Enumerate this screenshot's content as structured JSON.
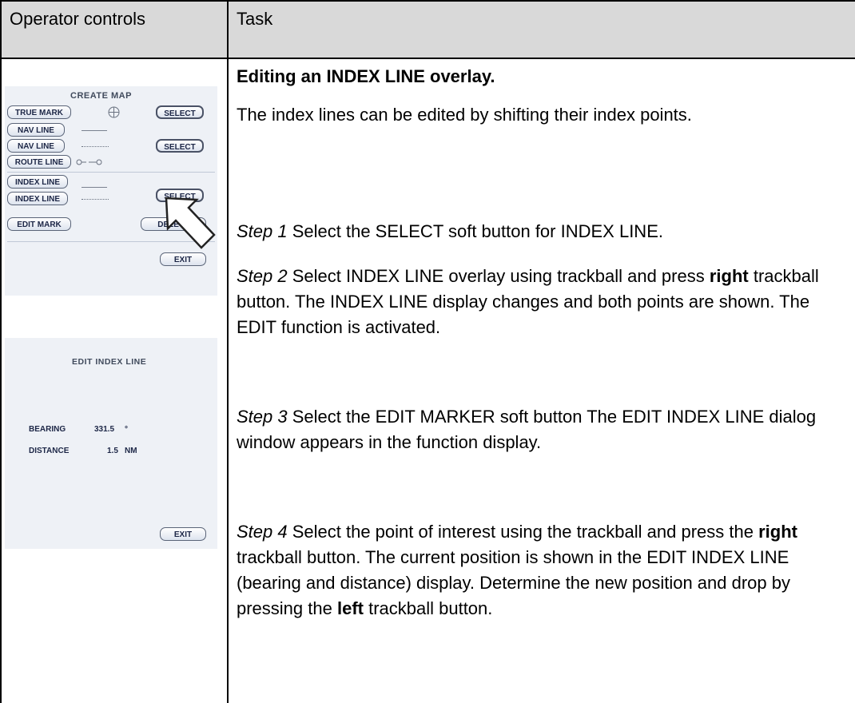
{
  "table": {
    "col1_header": "Operator controls",
    "col2_header": "Task"
  },
  "task": {
    "heading": "Editing an INDEX LINE overlay.",
    "intro": "The index lines can be edited by shifting their index points.",
    "step1": {
      "label": "Step 1",
      "text": " Select the SELECT soft button for INDEX LINE."
    },
    "step2": {
      "label": "Step 2",
      "text_a": " Select INDEX LINE overlay using trackball and press ",
      "bold": "right",
      "text_b": " trackball button. The INDEX LINE display changes and both points are shown. The EDIT function is activated."
    },
    "step3": {
      "label": "Step 3",
      "text": " Select the EDIT MARKER soft button The EDIT INDEX LINE dialog window appears in the function display."
    },
    "step4": {
      "label": "Step 4",
      "text_a": " Select the point of interest using the trackball and press the ",
      "bold1": "right",
      "text_b": " trackball button. The current position is shown in the EDIT INDEX LINE (bearing and distance) display. Determine the new position and drop by pressing the ",
      "bold2": "left",
      "text_c": " trackball button."
    }
  },
  "create_map_panel": {
    "title": "CREATE MAP",
    "true_mark": "TRUE MARK",
    "nav_line_1": "NAV LINE",
    "nav_line_2": "NAV LINE",
    "route_line": "ROUTE LINE",
    "index_line_1": "INDEX LINE",
    "index_line_2": "INDEX LINE",
    "select_1": "SELECT",
    "select_2": "SELECT",
    "select_3": "SELECT",
    "edit_mark": "EDIT MARK",
    "delete": "DELETE",
    "exit": "EXIT"
  },
  "edit_index_panel": {
    "title": "EDIT INDEX LINE",
    "bearing_label": "BEARING",
    "bearing_value": "331.5",
    "bearing_unit": "°",
    "distance_label": "DISTANCE",
    "distance_value": "1.5",
    "distance_unit": "NM",
    "exit": "EXIT"
  },
  "colors": {
    "header_bg": "#d9d9d9",
    "panel_bg": "#eef1f6",
    "button_text": "#1c2646"
  }
}
